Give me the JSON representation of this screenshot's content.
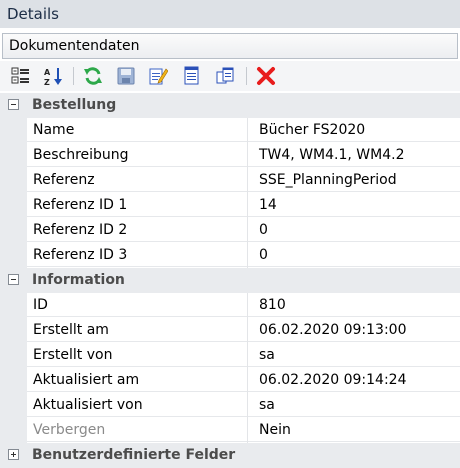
{
  "panel": {
    "title": "Details"
  },
  "selector": {
    "value": "Dokumentendaten"
  },
  "toolbar": {
    "buttons": [
      {
        "icon": "categorized-icon"
      },
      {
        "icon": "sort-alphabetical-icon"
      },
      {
        "icon": "refresh-icon"
      },
      {
        "icon": "save-icon"
      },
      {
        "icon": "edit-icon"
      },
      {
        "icon": "document-icon"
      },
      {
        "icon": "copy-icon"
      },
      {
        "icon": "delete-icon"
      }
    ]
  },
  "categories": [
    {
      "name": "Bestellung",
      "expanded": true,
      "rows": [
        {
          "label": "Name",
          "value": "Bücher FS2020"
        },
        {
          "label": "Beschreibung",
          "value": "TW4, WM4.1, WM4.2"
        },
        {
          "label": "Referenz",
          "value": "SSE_PlanningPeriod"
        },
        {
          "label": "Referenz ID 1",
          "value": "14"
        },
        {
          "label": "Referenz ID 2",
          "value": "0"
        },
        {
          "label": "Referenz ID 3",
          "value": "0"
        }
      ]
    },
    {
      "name": "Information",
      "expanded": true,
      "rows": [
        {
          "label": "ID",
          "value": "810"
        },
        {
          "label": "Erstellt am",
          "value": "06.02.2020 09:13:00"
        },
        {
          "label": "Erstellt von",
          "value": "sa"
        },
        {
          "label": "Aktualisiert am",
          "value": "06.02.2020 09:14:24"
        },
        {
          "label": "Aktualisiert von",
          "value": "sa"
        },
        {
          "label": "Verbergen",
          "value": "Nein",
          "disabled": true
        }
      ]
    },
    {
      "name": "Benutzerdefinierte Felder",
      "expanded": false,
      "rows": []
    }
  ],
  "colors": {
    "delete": "#e81c1c",
    "refresh": "#2da84a",
    "category_bg": "#e9ebee",
    "title_bg": "#dde1e6"
  }
}
